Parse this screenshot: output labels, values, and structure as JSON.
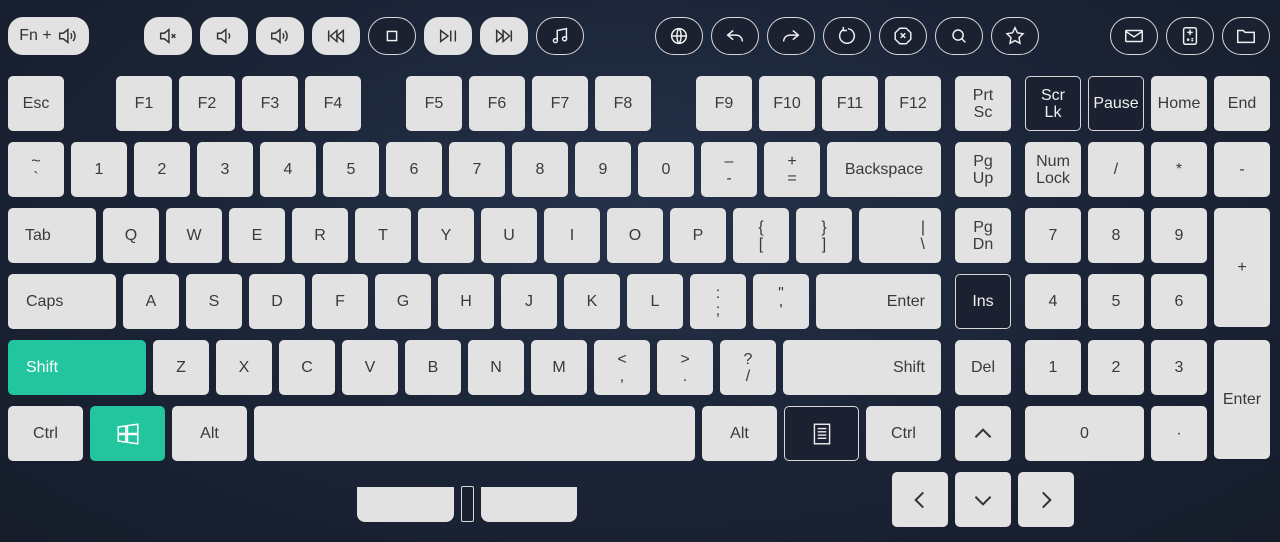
{
  "toolbar": {
    "fn_label": "Fn +",
    "media": [
      {
        "name": "mute-icon"
      },
      {
        "name": "volume-down-icon"
      },
      {
        "name": "volume-up-icon"
      },
      {
        "name": "previous-track-icon"
      },
      {
        "name": "stop-icon"
      },
      {
        "name": "play-pause-icon"
      },
      {
        "name": "next-track-icon"
      },
      {
        "name": "music-icon"
      }
    ],
    "browser": [
      {
        "name": "globe-icon"
      },
      {
        "name": "back-icon"
      },
      {
        "name": "forward-icon"
      },
      {
        "name": "refresh-icon"
      },
      {
        "name": "stop-loading-icon"
      },
      {
        "name": "search-icon"
      },
      {
        "name": "favorites-icon"
      }
    ],
    "apps": [
      {
        "name": "mail-icon"
      },
      {
        "name": "calculator-icon"
      },
      {
        "name": "folder-icon"
      }
    ]
  },
  "keys": {
    "esc": "Esc",
    "f1": "F1",
    "f2": "F2",
    "f3": "F3",
    "f4": "F4",
    "f5": "F5",
    "f6": "F6",
    "f7": "F7",
    "f8": "F8",
    "f9": "F9",
    "f10": "F10",
    "f11": "F11",
    "f12": "F12",
    "prtsc_1": "Prt",
    "prtsc_2": "Sc",
    "scrlk_1": "Scr",
    "scrlk_2": "Lk",
    "pause": "Pause",
    "home": "Home",
    "end": "End",
    "tilde_1": "~",
    "tilde_2": "`",
    "n1": "1",
    "n2": "2",
    "n3": "3",
    "n4": "4",
    "n5": "5",
    "n6": "6",
    "n7": "7",
    "n8": "8",
    "n9": "9",
    "n0": "0",
    "minus_1": "–",
    "minus_2": "-",
    "equal_1": "+",
    "equal_2": "=",
    "backspace": "Backspace",
    "pgup_1": "Pg",
    "pgup_2": "Up",
    "numlock_1": "Num",
    "numlock_2": "Lock",
    "np_slash": "/",
    "np_star": "*",
    "np_minus": "-",
    "tab": "Tab",
    "q": "Q",
    "w": "W",
    "e": "E",
    "r": "R",
    "t": "T",
    "y": "Y",
    "u": "U",
    "i": "I",
    "o": "O",
    "p": "P",
    "lbr_1": "{",
    "lbr_2": "[",
    "rbr_1": "}",
    "rbr_2": "]",
    "bsl_1": "|",
    "bsl_2": "\\",
    "pgdn_1": "Pg",
    "pgdn_2": "Dn",
    "np7": "7",
    "np8": "8",
    "np9": "9",
    "np_plus": "+",
    "caps": "Caps",
    "a": "A",
    "s": "S",
    "d": "D",
    "f": "F",
    "g": "G",
    "h": "H",
    "j": "J",
    "k": "K",
    "l": "L",
    "semi_1": ":",
    "semi_2": ";",
    "quote_1": "\"",
    "quote_2": "'",
    "enter": "Enter",
    "ins": "Ins",
    "np4": "4",
    "np5": "5",
    "np6": "6",
    "shift": "Shift",
    "z": "Z",
    "x": "X",
    "c": "C",
    "v": "V",
    "b": "B",
    "n": "N",
    "m": "M",
    "comma_1": "<",
    "comma_2": ",",
    "period_1": ">",
    "period_2": ".",
    "slash_1": "?",
    "slash_2": "/",
    "rshift": "Shift",
    "del": "Del",
    "np1": "1",
    "np2": "2",
    "np3": "3",
    "np_enter": "Enter",
    "ctrl": "Ctrl",
    "alt": "Alt",
    "ralt": "Alt",
    "rctrl": "Ctrl",
    "np0": "0",
    "np_dot": "·"
  },
  "colors": {
    "accent": "#22c59d",
    "key": "#e2e2e2",
    "background": "#1b2436"
  }
}
